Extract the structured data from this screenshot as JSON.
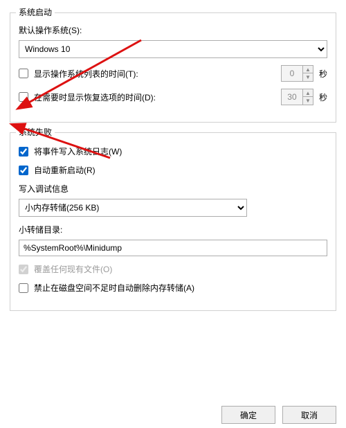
{
  "group1": {
    "title": "系统启动",
    "default_os_label": "默认操作系统(S):",
    "default_os_value": "Windows 10",
    "timeout_os_label": "显示操作系统列表的时间(T):",
    "timeout_os_value": "0",
    "timeout_recovery_label": "在需要时显示恢复选项的时间(D):",
    "timeout_recovery_value": "30",
    "seconds_unit": "秒"
  },
  "group2": {
    "title": "系统失败",
    "log_event_label": "将事件写入系统日志(W)",
    "auto_restart_label": "自动重新启动(R)",
    "debug_header": "写入调试信息",
    "dump_select_value": "小内存转储(256 KB)",
    "dump_dir_label": "小转储目录:",
    "dump_dir_value": "%SystemRoot%\\Minidump",
    "overwrite_label": "覆盖任何现有文件(O)",
    "nodelete_label": "禁止在磁盘空间不足时自动删除内存转储(A)"
  },
  "footer": {
    "ok": "确定",
    "cancel": "取消"
  }
}
